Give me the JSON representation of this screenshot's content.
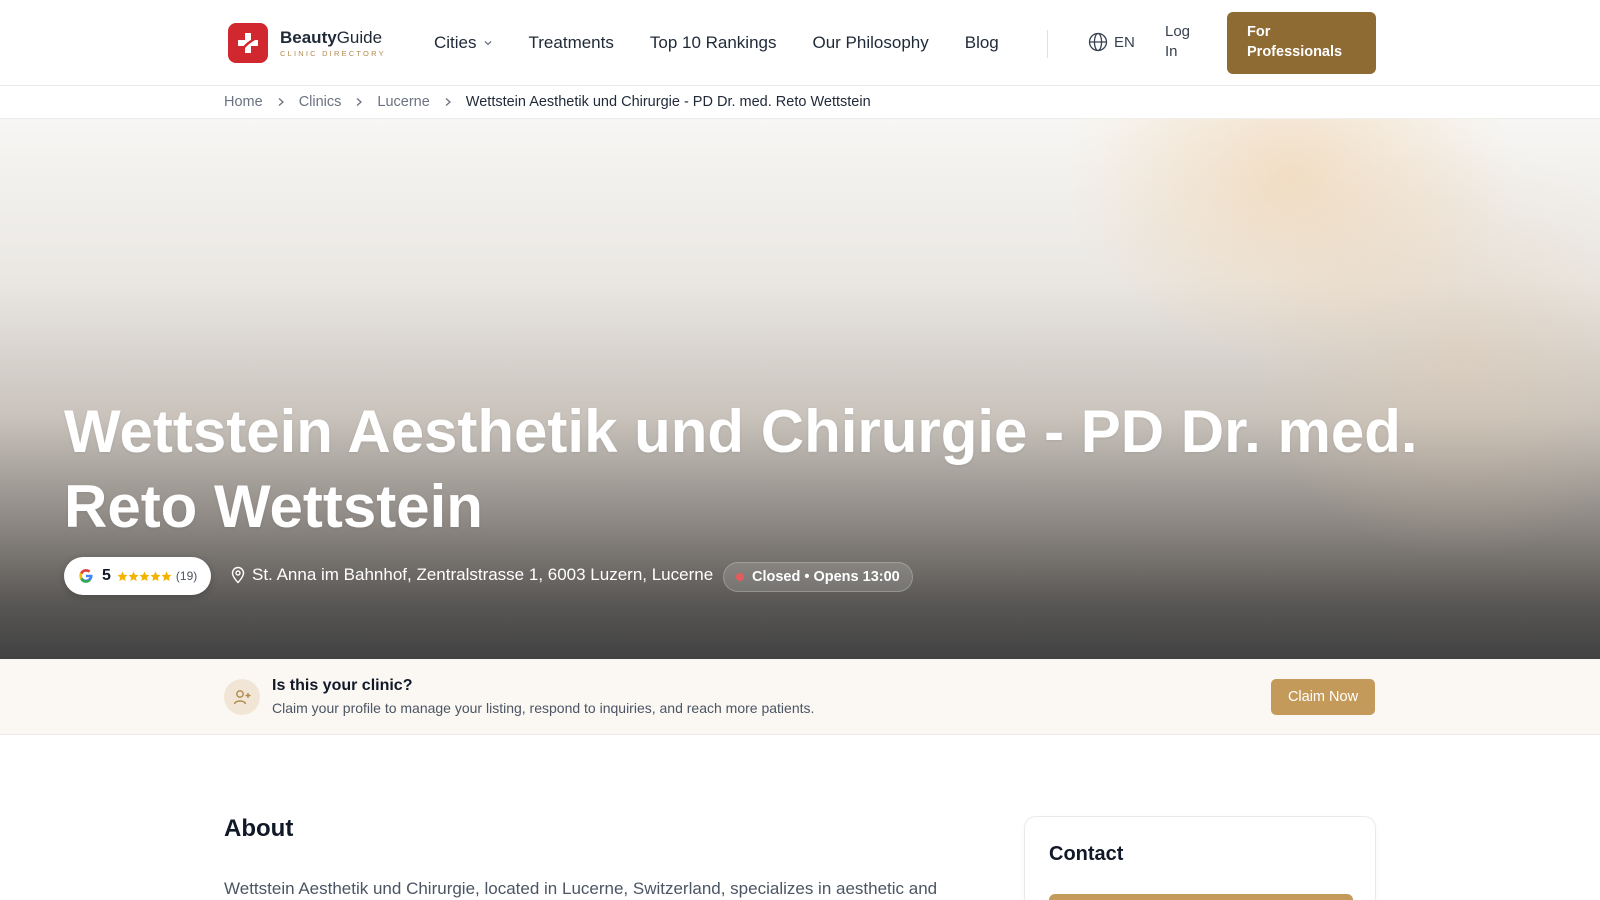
{
  "header": {
    "brand_bold": "Beauty",
    "brand_rest": "Guide",
    "tagline": "CLINIC DIRECTORY",
    "nav": [
      {
        "label": "Cities"
      },
      {
        "label": "Treatments"
      },
      {
        "label": "Top 10 Rankings"
      },
      {
        "label": "Our Philosophy"
      },
      {
        "label": "Blog"
      }
    ],
    "language": "EN",
    "login": "Log In",
    "pro_button": "For Professionals"
  },
  "breadcrumb": [
    "Home",
    "Clinics",
    "Lucerne",
    "Wettstein Aesthetik und Chirurgie - PD Dr. med. Reto Wettstein"
  ],
  "hero": {
    "title": "Wettstein Aesthetik und Chirurgie - PD Dr. med. Reto Wettstein",
    "rating": {
      "score": "5",
      "stars": 5,
      "count": "(19)"
    },
    "address": "St. Anna im Bahnhof, Zentralstrasse 1, 6003 Luzern, Lucerne",
    "status": "Closed • Opens 13:00"
  },
  "claim": {
    "title": "Is this your clinic?",
    "description": "Claim your profile to manage your listing, respond to inquiries, and reach more patients.",
    "button": "Claim Now"
  },
  "about": {
    "title": "About",
    "text": "Wettstein Aesthetik und Chirurgie, located in Lucerne, Switzerland, specializes in aesthetic and"
  },
  "contact": {
    "title": "Contact"
  },
  "colors": {
    "brand_red": "#d1272e",
    "gold_dark": "#8f6b34",
    "gold": "#c49a5b",
    "star": "#f5b301",
    "status_red": "#e45b5b"
  }
}
